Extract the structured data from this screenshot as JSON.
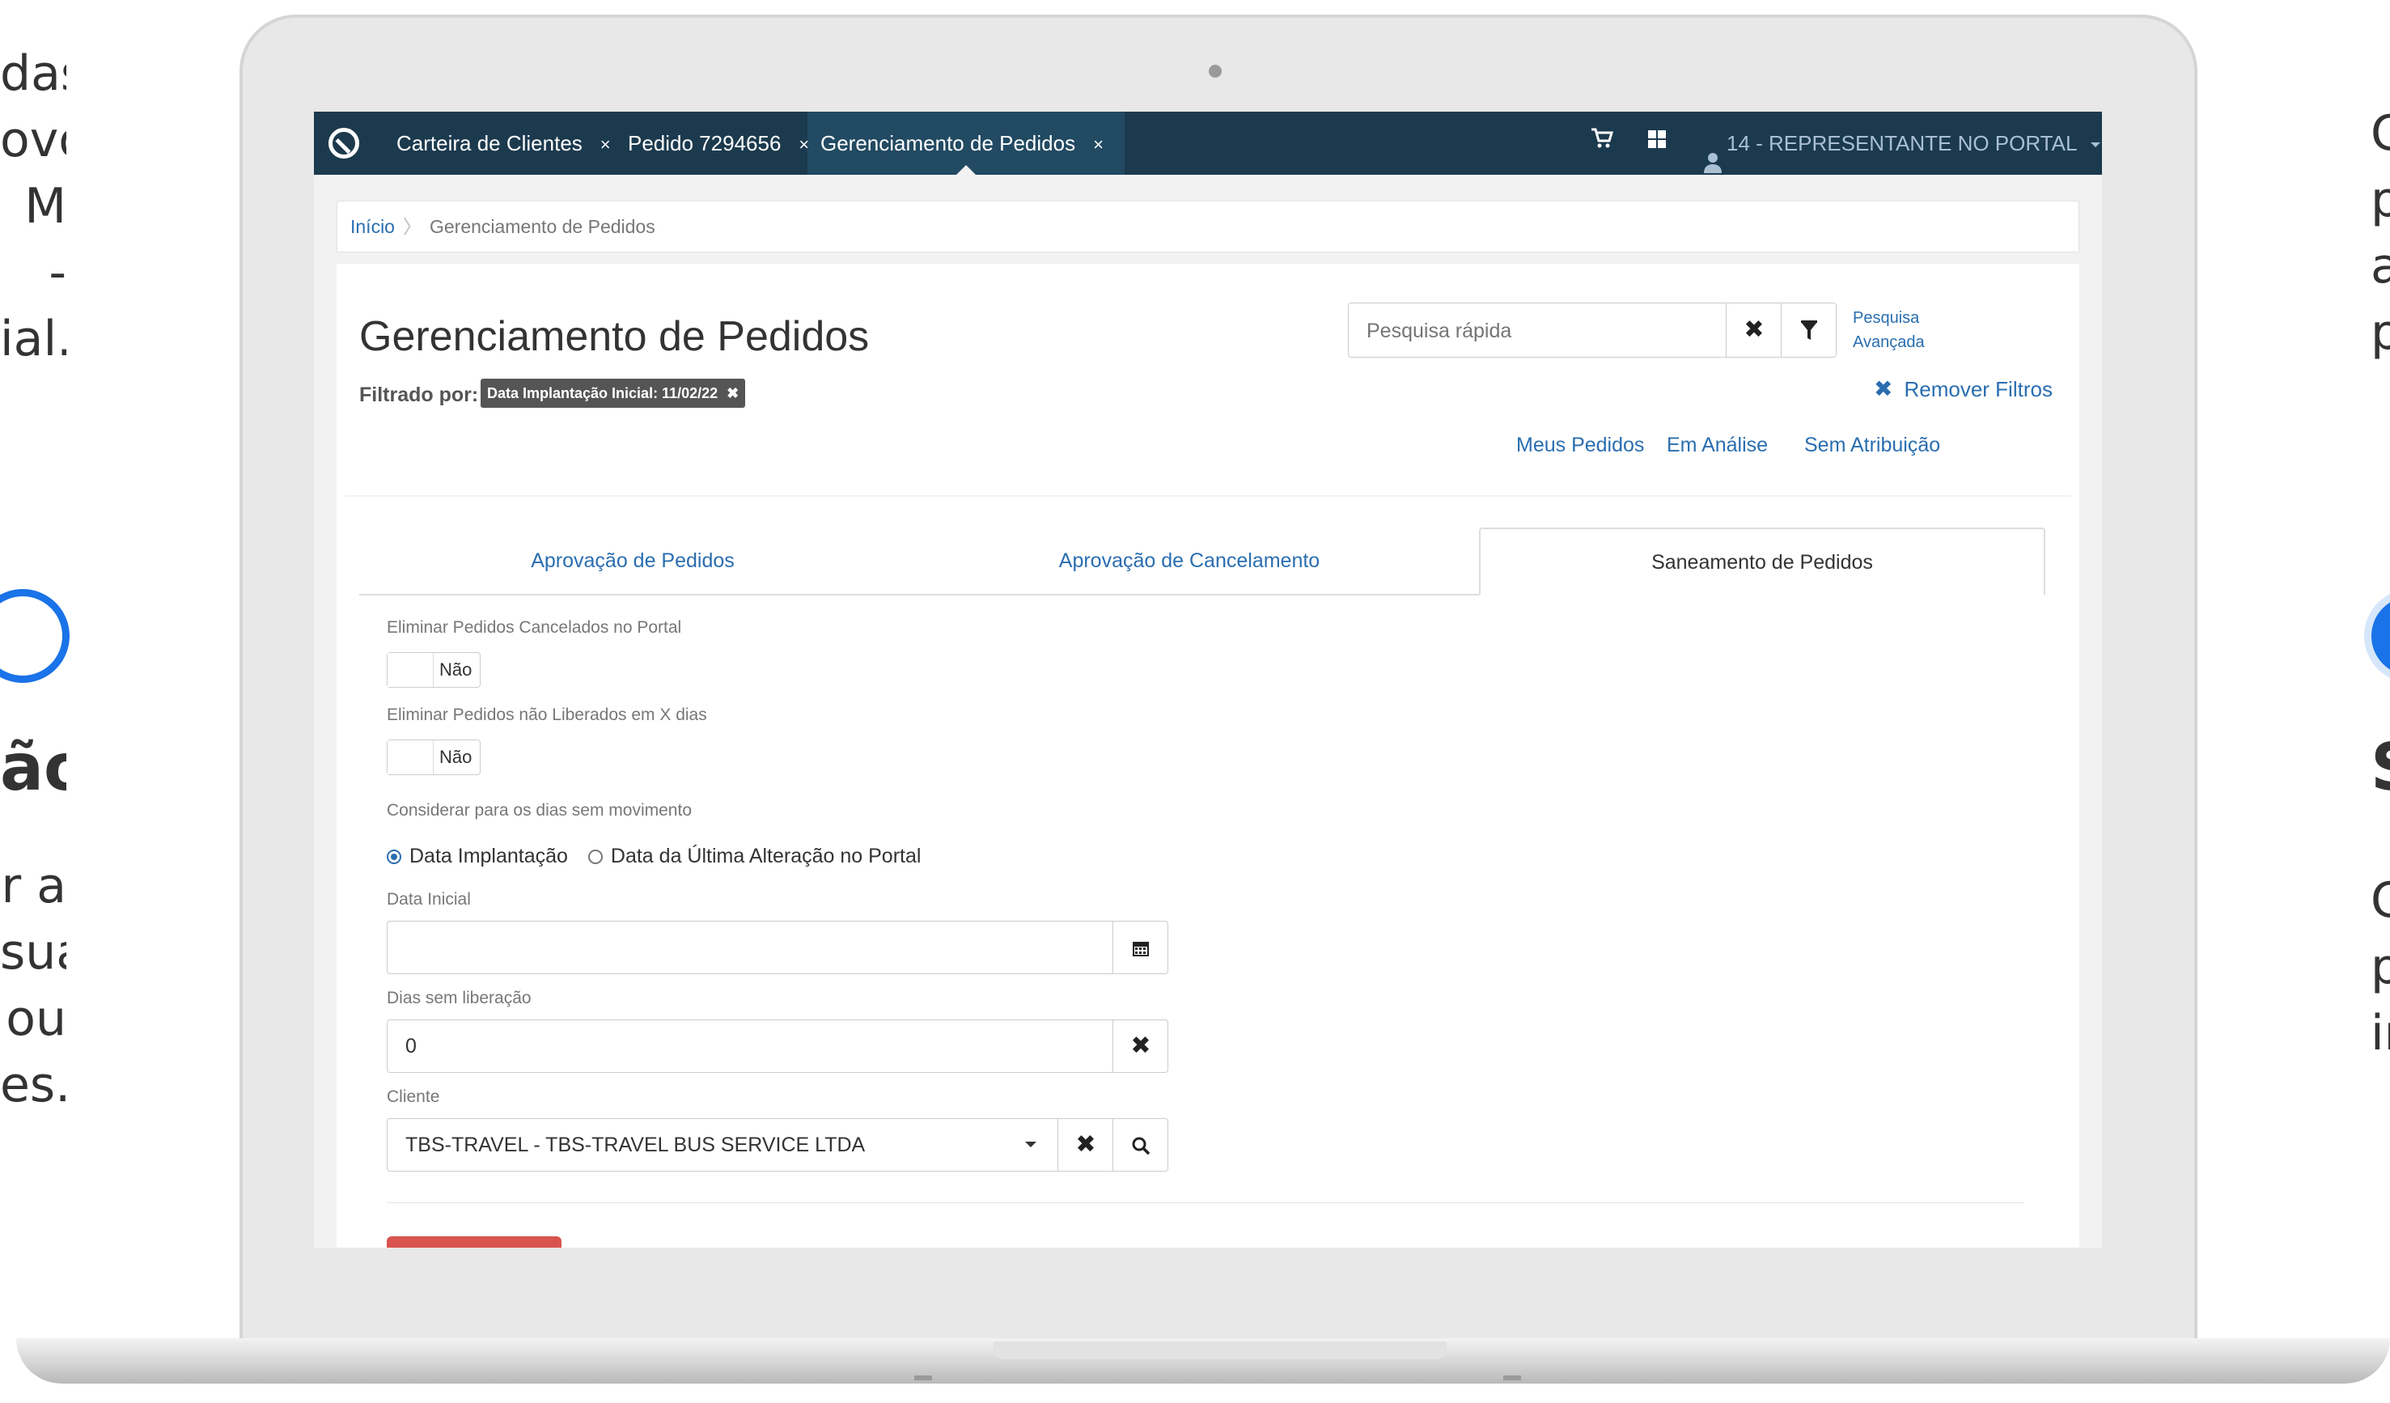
{
  "side_left": {
    "lines_top": [
      "das",
      "ovo",
      "M -",
      "ial."
    ],
    "title": "ão",
    "lines_bottom": [
      "r a",
      "sua",
      "ou",
      "es."
    ]
  },
  "side_right": {
    "lines_top": [
      "C",
      "p",
      "a",
      "p"
    ],
    "title": "S",
    "lines_bottom": [
      "C",
      "p",
      "ir"
    ]
  },
  "topbar": {
    "tabs": [
      {
        "label": "Carteira de Clientes",
        "close": "×"
      },
      {
        "label": "Pedido 7294656",
        "close": "×"
      },
      {
        "label": "Gerenciamento de Pedidos",
        "close": "×"
      }
    ],
    "cart_icon": "cart-icon",
    "apps_icon": "grid-icon",
    "user_label": "14 - REPRESENTANTE NO PORTAL"
  },
  "breadcrumb": {
    "home": "Início",
    "current": "Gerenciamento de Pedidos"
  },
  "header": {
    "title": "Gerenciamento de Pedidos",
    "filter_label": "Filtrado por:",
    "filter_badge": "Data Implantação Inicial: 11/02/22",
    "search_placeholder": "Pesquisa rápida",
    "advanced_line1": "Pesquisa",
    "advanced_line2": "Avançada",
    "remove_filters": "Remover Filtros",
    "quick_links": [
      "Meus Pedidos",
      "Em Análise",
      "Sem Atribuição"
    ]
  },
  "tabs": [
    "Aprovação de Pedidos",
    "Aprovação de Cancelamento",
    "Saneamento de Pedidos"
  ],
  "form": {
    "eliminar_cancelados_label": "Eliminar Pedidos Cancelados no Portal",
    "eliminar_cancelados_value": "Não",
    "eliminar_nao_liberados_label": "Eliminar Pedidos não Liberados em X dias",
    "eliminar_nao_liberados_value": "Não",
    "considerar_label": "Considerar para os dias sem movimento",
    "radio_option1": "Data Implantação",
    "radio_option2": "Data da Última Alteração no Portal",
    "data_inicial_label": "Data Inicial",
    "data_inicial_value": "",
    "dias_label": "Dias sem liberação",
    "dias_value": "0",
    "cliente_label": "Cliente",
    "cliente_value": "TBS-TRAVEL - TBS-TRAVEL BUS SERVICE LTDA"
  },
  "colors": {
    "topbar": "#1c3a4e",
    "link": "#2a6eb0",
    "danger": "#d9534f",
    "accent_ring": "#1a73e8"
  }
}
